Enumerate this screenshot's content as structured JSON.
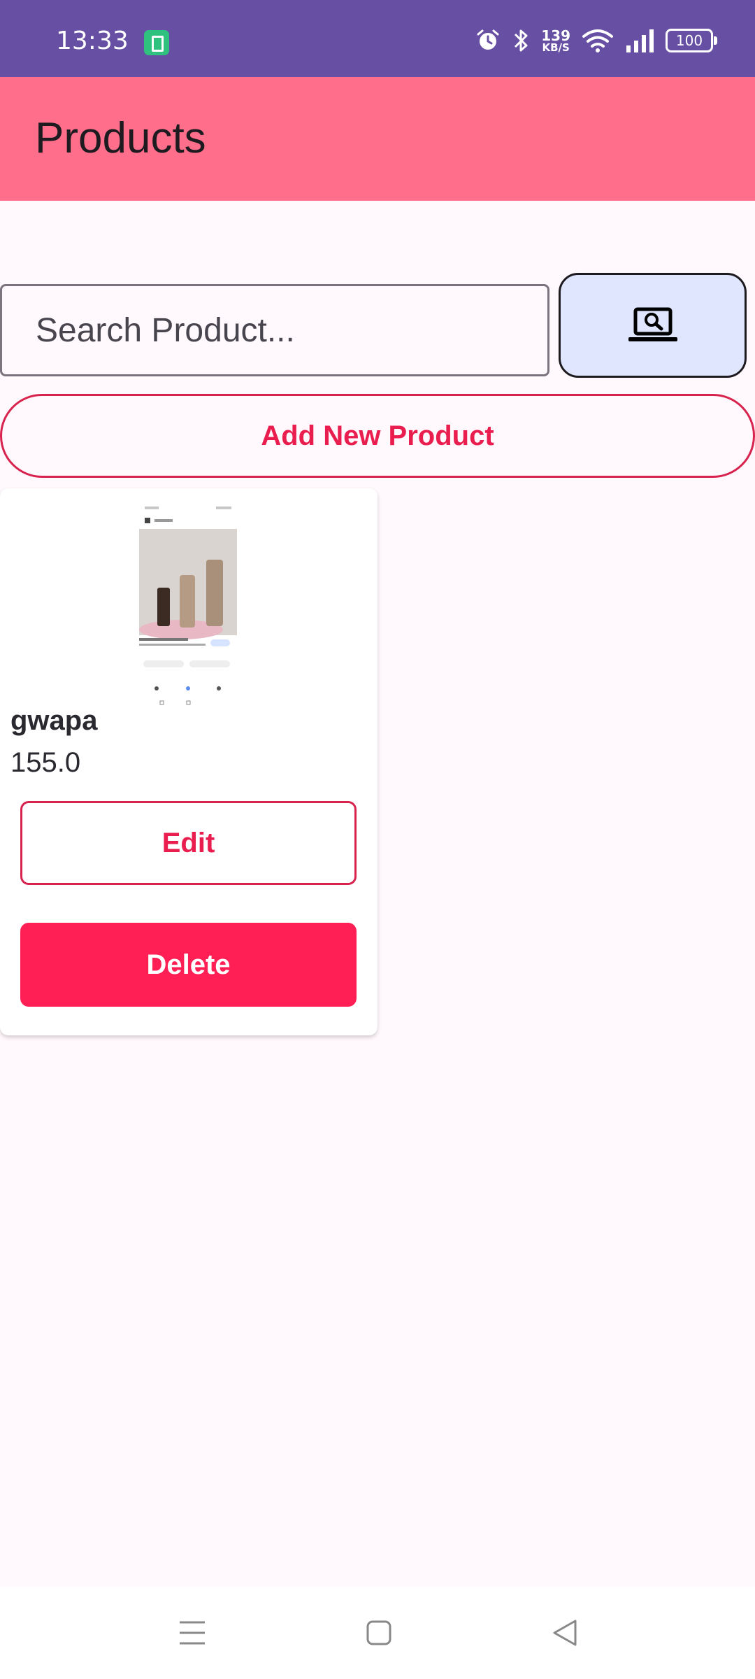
{
  "status_bar": {
    "time": "13:33",
    "net_speed_value": "139",
    "net_speed_unit": "KB/S",
    "battery_level": "100",
    "icons": [
      "battery-saver-icon",
      "alarm-icon",
      "bluetooth-icon",
      "wifi-icon",
      "signal-icon",
      "battery-icon"
    ]
  },
  "app_bar": {
    "title": "Products",
    "color": "#ff6e8a"
  },
  "search": {
    "placeholder": "Search Product...",
    "value": ""
  },
  "search_button": {
    "icon": "laptop-search-icon"
  },
  "add_button": {
    "label": "Add New Product"
  },
  "products": [
    {
      "name": "gwapa",
      "price": "155.0",
      "edit_label": "Edit",
      "delete_label": "Delete"
    }
  ],
  "nav_bar": {
    "icons": [
      "menu-icon",
      "home-icon",
      "back-icon"
    ]
  },
  "colors": {
    "status_bar": "#6750a4",
    "accent": "#e91e4f",
    "delete": "#ff1f55",
    "search_button_bg": "#e1e6ff"
  }
}
